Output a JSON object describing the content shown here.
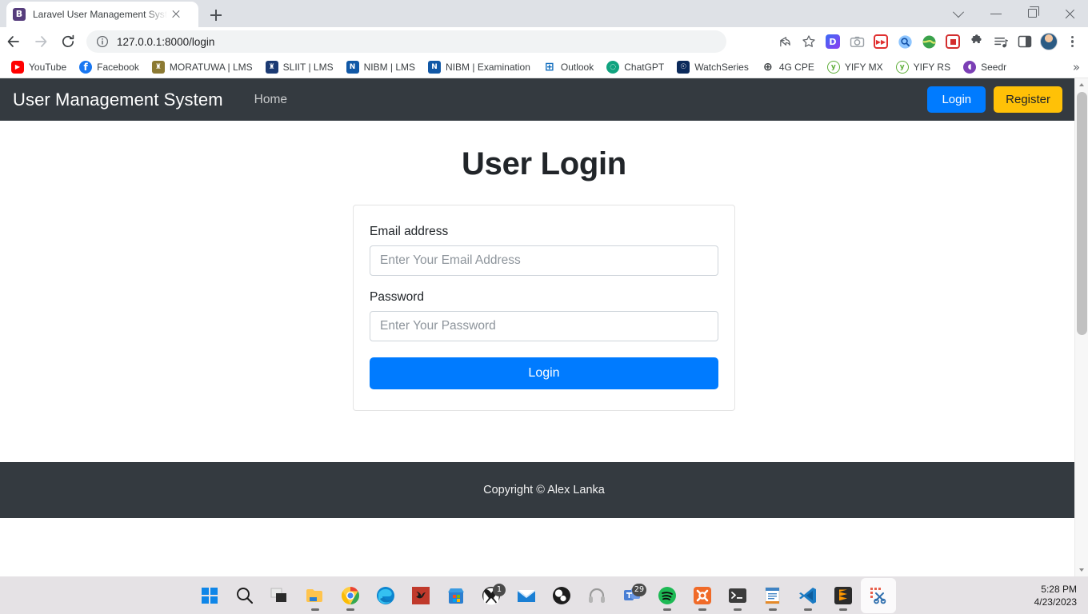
{
  "browser": {
    "tab": {
      "favicon_letter": "B",
      "title": "Laravel User Management System",
      "close_icon": "close-icon"
    },
    "new_tab_icon": "plus-icon",
    "window_controls": [
      {
        "name": "tab-search",
        "icon": "chevron-down-icon"
      },
      {
        "name": "minimize",
        "icon": "minimize-icon"
      },
      {
        "name": "maximize",
        "icon": "maximize-icon"
      },
      {
        "name": "close",
        "icon": "close-icon"
      }
    ],
    "nav": {
      "back_icon": "back-arrow-icon",
      "forward_icon": "forward-arrow-icon",
      "reload_icon": "reload-icon"
    },
    "omnibox": {
      "info_icon": "info-circle-icon",
      "url": "127.0.0.1:8000/login"
    },
    "toolbar_icons": [
      {
        "name": "share-icon",
        "glyph": "⤴"
      },
      {
        "name": "bookmark-star-icon",
        "glyph": "☆"
      },
      {
        "name": "extension-dashlane-icon",
        "letter": "D",
        "color": "#1d6af4"
      },
      {
        "name": "extension-screenshot-icon",
        "letter": "",
        "color": "#9aa0a6"
      },
      {
        "name": "extension-idm-icon",
        "letter": "▶▶",
        "color": "#e03030"
      },
      {
        "name": "extension-search-icon",
        "letter": "",
        "color": "#4b9cff"
      },
      {
        "name": "extension-globe-icon",
        "letter": "",
        "color": "#35a24b"
      },
      {
        "name": "extension-record-icon",
        "letter": "",
        "color": "#d32f2f"
      },
      {
        "name": "extensions-puzzle-icon",
        "letter": "",
        "color": "#4d5156"
      },
      {
        "name": "media-playlist-icon",
        "letter": "",
        "color": "#4d5156"
      },
      {
        "name": "side-panel-icon",
        "letter": "",
        "color": "#4d5156"
      },
      {
        "name": "profile-avatar",
        "letter": "",
        "color": "#2b5b84"
      },
      {
        "name": "chrome-menu-icon",
        "letter": "",
        "color": "#5f6368"
      }
    ],
    "bookmarks": [
      {
        "label": "YouTube",
        "icon": "youtube-icon",
        "color": "#ff0000",
        "glyph": "▶"
      },
      {
        "label": "Facebook",
        "icon": "facebook-icon",
        "color": "#1877f2",
        "glyph": "f"
      },
      {
        "label": "MORATUWA | LMS",
        "icon": "moratuwa-crest-icon",
        "color": "#8c7a33",
        "glyph": "♜"
      },
      {
        "label": "SLIIT | LMS",
        "icon": "sliit-crest-icon",
        "color": "#1b3a73",
        "glyph": "♜"
      },
      {
        "label": "NIBM | LMS",
        "icon": "nibm-icon",
        "color": "#1158a6",
        "glyph": "N"
      },
      {
        "label": "NIBM | Examination",
        "icon": "nibm-icon",
        "color": "#1158a6",
        "glyph": "N"
      },
      {
        "label": "Outlook",
        "icon": "outlook-icon",
        "color": "#0f6cbd",
        "glyph": "⊞"
      },
      {
        "label": "ChatGPT",
        "icon": "chatgpt-icon",
        "color": "#10a37f",
        "glyph": "◌"
      },
      {
        "label": "WatchSeries",
        "icon": "watchseries-icon",
        "color": "#0b2a5b",
        "glyph": "☉"
      },
      {
        "label": "4G CPE",
        "icon": "globe-icon",
        "color": "#3c4043",
        "glyph": "⊕"
      },
      {
        "label": "YIFY MX",
        "icon": "yify-icon",
        "color": "#5fae3a",
        "glyph": "y"
      },
      {
        "label": "YIFY RS",
        "icon": "yify-icon",
        "color": "#5fae3a",
        "glyph": "y"
      },
      {
        "label": "Seedr",
        "icon": "seedr-icon",
        "color": "#7b3fb5",
        "glyph": "◖"
      }
    ],
    "bookmarks_overflow": "»"
  },
  "page": {
    "navbar": {
      "brand": "User Management System",
      "home_link": "Home",
      "login_button": "Login",
      "register_button": "Register",
      "bg_color": "#343a40",
      "login_color": "#007bff",
      "register_color": "#ffc107"
    },
    "title": "User Login",
    "form": {
      "email_label": "Email address",
      "email_placeholder": "Enter Your Email Address",
      "email_value": "",
      "password_label": "Password",
      "password_placeholder": "Enter Your Password",
      "password_value": "",
      "submit_label": "Login"
    },
    "footer": {
      "text": "Copyright © Alex Lanka"
    }
  },
  "taskbar": {
    "items": [
      {
        "name": "start-button",
        "icon": "windows-logo-icon",
        "badge": "",
        "state": ""
      },
      {
        "name": "search-button",
        "icon": "search-icon",
        "badge": "",
        "state": ""
      },
      {
        "name": "task-view-button",
        "icon": "task-view-icon",
        "badge": "",
        "state": ""
      },
      {
        "name": "file-explorer",
        "icon": "folder-icon",
        "badge": "",
        "state": "active"
      },
      {
        "name": "google-chrome",
        "icon": "chrome-icon",
        "badge": "",
        "state": "active"
      },
      {
        "name": "microsoft-edge",
        "icon": "edge-icon",
        "badge": "",
        "state": ""
      },
      {
        "name": "kali-linux",
        "icon": "kali-dragon-icon",
        "badge": "",
        "state": ""
      },
      {
        "name": "microsoft-store",
        "icon": "store-icon",
        "badge": "",
        "state": ""
      },
      {
        "name": "xbox",
        "icon": "xbox-icon",
        "badge": "1",
        "state": ""
      },
      {
        "name": "mail",
        "icon": "mail-icon",
        "badge": "",
        "state": ""
      },
      {
        "name": "obs-studio",
        "icon": "obs-icon",
        "badge": "",
        "state": ""
      },
      {
        "name": "headset-app",
        "icon": "headset-icon",
        "badge": "",
        "state": ""
      },
      {
        "name": "teams",
        "icon": "teams-icon",
        "badge": "29",
        "state": ""
      },
      {
        "name": "spotify",
        "icon": "spotify-icon",
        "badge": "",
        "state": "active"
      },
      {
        "name": "xampp",
        "icon": "xampp-icon",
        "badge": "",
        "state": "active"
      },
      {
        "name": "terminal",
        "icon": "terminal-icon",
        "badge": "",
        "state": "active"
      },
      {
        "name": "notepad",
        "icon": "notepad-icon",
        "badge": "",
        "state": "active"
      },
      {
        "name": "visual-studio-code",
        "icon": "vscode-icon",
        "badge": "",
        "state": "active"
      },
      {
        "name": "sublime-text",
        "icon": "sublime-icon",
        "badge": "",
        "state": "active"
      },
      {
        "name": "snipping-tool",
        "icon": "snipping-tool-icon",
        "badge": "",
        "state": "focus"
      }
    ],
    "clock": {
      "time": "5:28 PM",
      "date": "4/23/2023"
    }
  }
}
